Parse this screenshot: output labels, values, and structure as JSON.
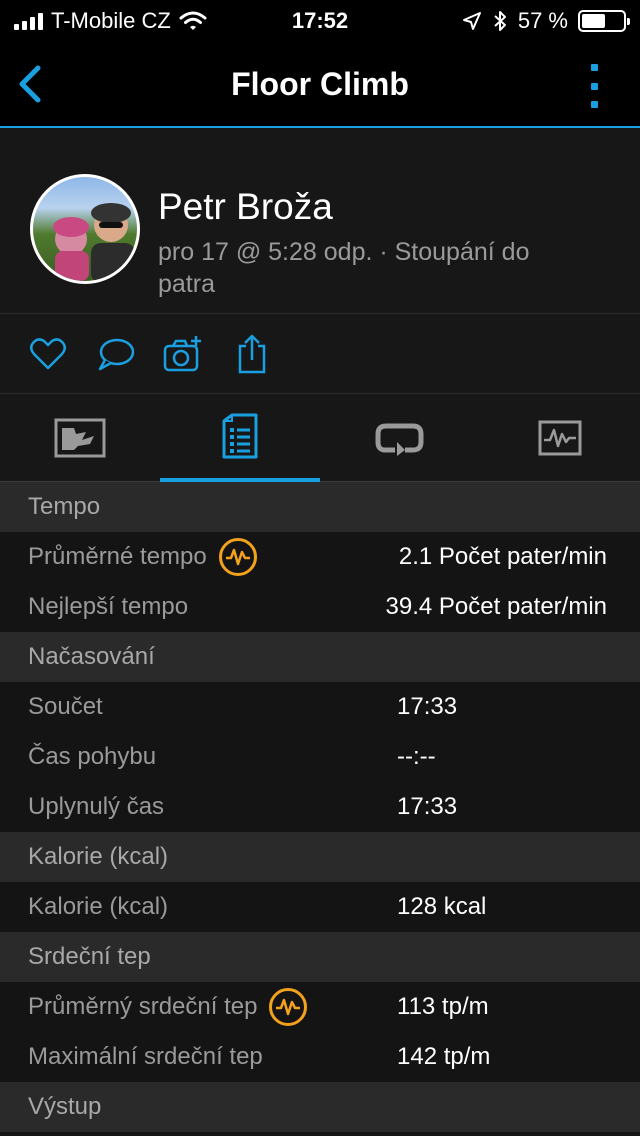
{
  "status_bar": {
    "carrier": "T-Mobile CZ",
    "time": "17:52",
    "battery": "57 %",
    "battery_level": 0.57
  },
  "nav": {
    "title": "Floor Climb"
  },
  "profile": {
    "name": "Petr Broža",
    "meta": "pro 17 @ 5:28 odp. · Stoupání do patra"
  },
  "sections": {
    "tempo": {
      "title": "Tempo",
      "avg_label": "Průměrné tempo",
      "avg_value": "2.1 Počet pater/min",
      "best_label": "Nejlepší tempo",
      "best_value": "39.4 Počet pater/min"
    },
    "timing": {
      "title": "Načasování",
      "total_label": "Součet",
      "total_value": "17:33",
      "moving_label": "Čas pohybu",
      "moving_value": "--:--",
      "elapsed_label": "Uplynulý čas",
      "elapsed_value": "17:33"
    },
    "calories": {
      "title": "Kalorie (kcal)",
      "label": "Kalorie (kcal)",
      "value": "128 kcal"
    },
    "heart": {
      "title": "Srdeční tep",
      "avg_label": "Průměrný srdeční tep",
      "avg_value": "113 tp/m",
      "max_label": "Maximální srdeční tep",
      "max_value": "142 tp/m"
    },
    "ascent": {
      "title": "Výstup"
    }
  },
  "colors": {
    "accent": "#1a9fe0",
    "heart_rate_icon": "#f4a21d",
    "section_bg": "#2a2a2a",
    "row_bg": "#141414"
  },
  "icons": [
    "back-chevron-icon",
    "more-vertical-icon",
    "like-heart-icon",
    "comment-icon",
    "add-photo-icon",
    "share-icon",
    "overview-tab-icon",
    "details-tab-icon",
    "laps-tab-icon",
    "charts-tab-icon",
    "heart-rate-icon"
  ]
}
